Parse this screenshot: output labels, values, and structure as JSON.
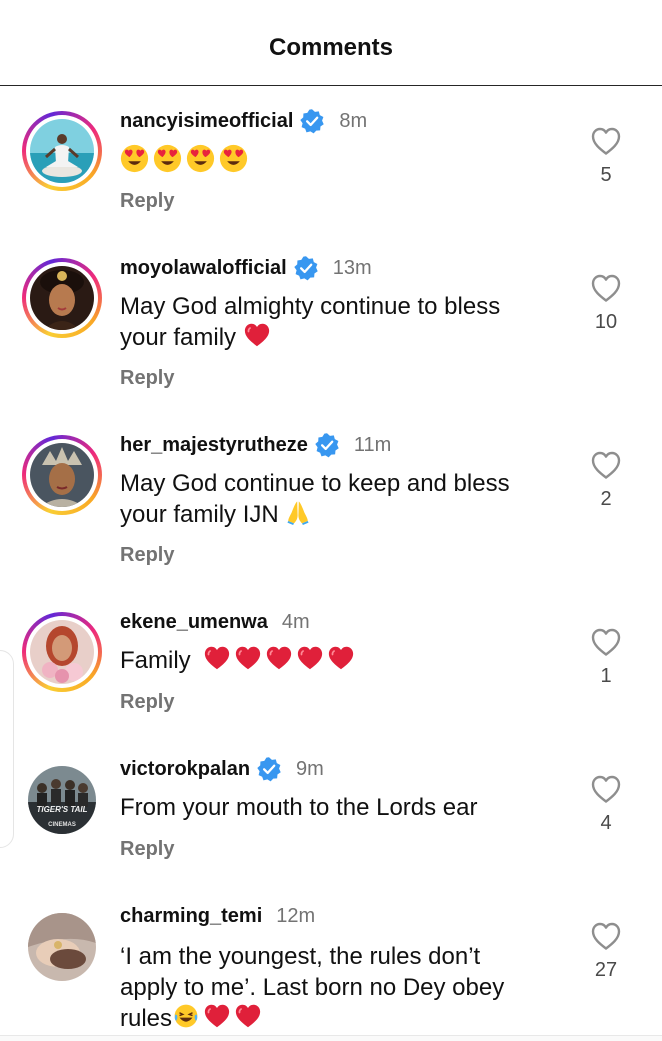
{
  "header": {
    "title": "Comments"
  },
  "comments": [
    {
      "username": "nancyisimeofficial",
      "verified": true,
      "time": "8m",
      "text": "",
      "emojis": [
        "heart-eyes-face",
        "heart-eyes-face",
        "heart-eyes-face",
        "heart-eyes-face"
      ],
      "reply": "Reply",
      "likes": "5",
      "avatar": "yoga-photo",
      "story_ring": true
    },
    {
      "username": "moyolawalofficial",
      "verified": true,
      "time": "13m",
      "text_line1": "May God almighty continue to bless",
      "text_line2": "your family",
      "emojis": [
        "red-heart"
      ],
      "reply": "Reply",
      "likes": "10",
      "avatar": "portrait-photo",
      "story_ring": true
    },
    {
      "username": "her_majestyrutheze",
      "verified": true,
      "time": "11m",
      "text_line1": "May God continue to keep and bless",
      "text_line2": "your family IJN",
      "emojis": [
        "folded-hands"
      ],
      "reply": "Reply",
      "likes": "2",
      "avatar": "crown-photo",
      "story_ring": true
    },
    {
      "username": "ekene_umenwa",
      "verified": false,
      "time": "4m",
      "text": "Family",
      "emojis": [
        "red-heart",
        "red-heart",
        "red-heart",
        "red-heart",
        "red-heart"
      ],
      "reply": "Reply",
      "likes": "1",
      "avatar": "flowers-photo",
      "story_ring": true
    },
    {
      "username": "victorokpalan",
      "verified": true,
      "time": "9m",
      "text": "From your mouth to the Lords ear",
      "reply": "Reply",
      "likes": "4",
      "avatar": "movie-poster",
      "avatar_text": "TIGER'S TAIL",
      "avatar_subtext": "CINEMAS",
      "story_ring": false
    },
    {
      "username": "charming_temi",
      "verified": false,
      "time": "12m",
      "text_line1": "‘I am the youngest, the rules don’t",
      "text_line2": "apply to me’. Last born no Dey obey",
      "text_line3": "rules",
      "emojis": [
        "laughing-face",
        "red-heart",
        "red-heart"
      ],
      "likes": "27",
      "avatar": "hands-photo",
      "story_ring": false
    }
  ],
  "colors": {
    "verified_blue": "#3897f0",
    "secondary_text": "#737373",
    "heart_red": "#e0203a"
  }
}
